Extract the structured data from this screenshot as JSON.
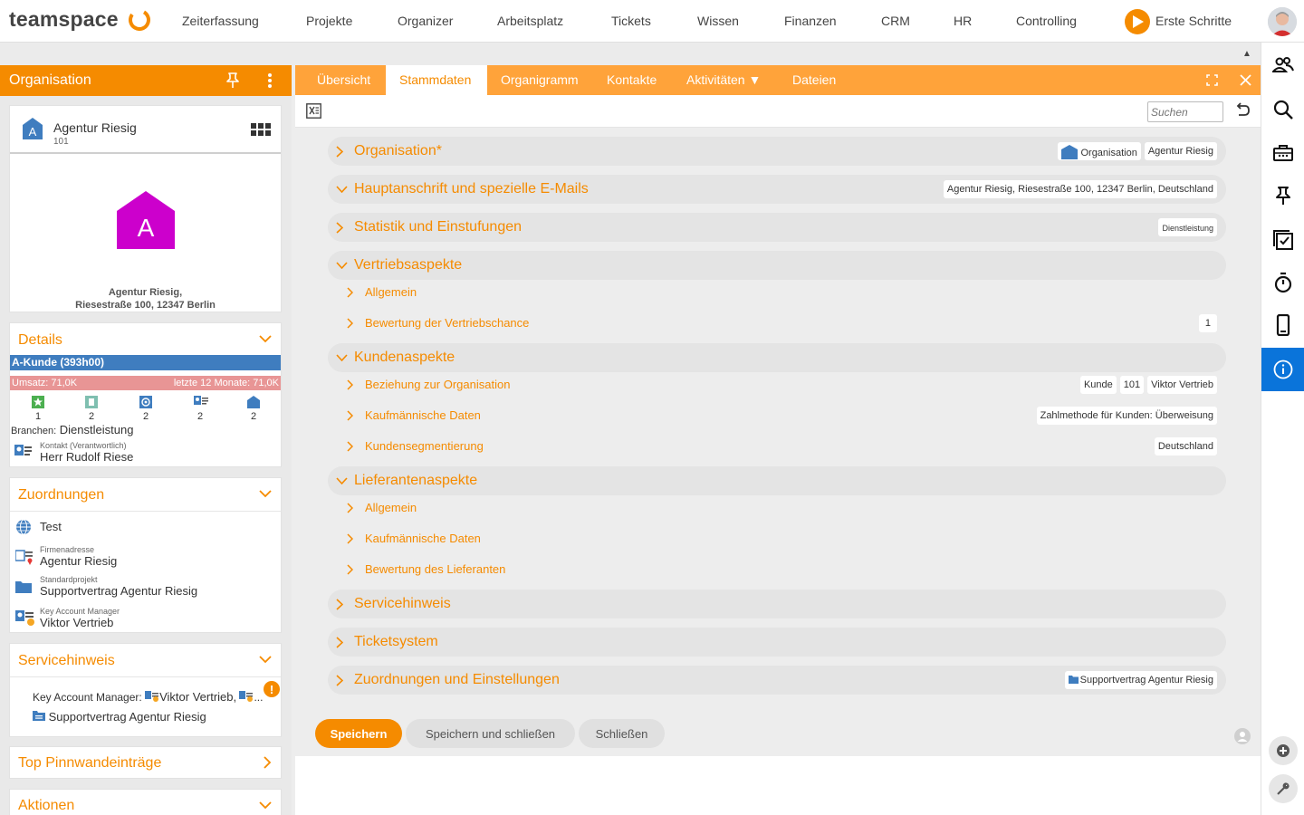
{
  "app": {
    "logo_text": "teamspace",
    "nav": [
      "Zeiterfassung",
      "Projekte",
      "Organizer",
      "Arbeitsplatz",
      "Tickets",
      "Wissen",
      "Finanzen",
      "CRM",
      "HR",
      "Controlling"
    ],
    "erste_schritte": "Erste Schritte"
  },
  "left": {
    "header_title": "Organisation",
    "entity": {
      "name": "Agentur Riesig",
      "number": "101",
      "big_letter": "A",
      "small_letter": "A",
      "address_line1": "Agentur Riesig,",
      "address_line2": "Riesestraße 100, 12347 Berlin"
    },
    "details": {
      "title": "Details",
      "kunde": "A-Kunde (393h00)",
      "umsatz": "Umsatz: 71,0K",
      "letzte": "letzte 12 Monate: 71,0K",
      "stats": [
        "1",
        "2",
        "2",
        "2",
        "2"
      ],
      "branchen_label": "Branchen:",
      "branchen_value": "Dienstleistung",
      "kontakt_label": "Kontakt (Verantwortlich)",
      "kontakt_name": "Herr Rudolf Riese"
    },
    "zuordnungen": {
      "title": "Zuordnungen",
      "test": "Test",
      "firmenadresse_label": "Firmenadresse",
      "firmenadresse_value": "Agentur Riesig",
      "standardprojekt_label": "Standardprojekt",
      "standardprojekt_value": "Supportvertrag Agentur Riesig",
      "kam_label": "Key Account Manager",
      "kam_value": "Viktor Vertrieb"
    },
    "servicehinweis": {
      "title": "Servicehinweis",
      "kam_prefix": "Key Account Manager:",
      "kam_value": "Viktor Vertrieb,",
      "ellipsis": "...",
      "project": "Supportvertrag Agentur Riesig",
      "warn_glyph": "!"
    },
    "pinnwand_title": "Top Pinnwandeinträge",
    "aktionen_title": "Aktionen"
  },
  "main": {
    "tabs": [
      "Übersicht",
      "Stammdaten",
      "Organigramm",
      "Kontakte",
      "Aktivitäten ▼",
      "Dateien"
    ],
    "active_tab": "Stammdaten",
    "search_placeholder": "Suchen",
    "sections": {
      "organisation": {
        "label": "Organisation*",
        "tag1": "Organisation",
        "tag2": "Agentur Riesig"
      },
      "hauptanschrift": {
        "label": "Hauptanschrift und spezielle E-Mails",
        "tag": "Agentur Riesig, Riesestraße 100, 12347 Berlin, Deutschland"
      },
      "statistik": {
        "label": "Statistik und Einstufungen",
        "tag": "Dienstleistung"
      },
      "vertrieb": {
        "label": "Vertriebsaspekte",
        "sub1": "Allgemein",
        "sub2": "Bewertung der Vertriebschance",
        "sub2_tag": "1"
      },
      "kunden": {
        "label": "Kundenaspekte",
        "sub1": "Beziehung zur Organisation",
        "sub1_tags": [
          "Kunde",
          "101",
          "Viktor Vertrieb"
        ],
        "sub2": "Kaufmännische Daten",
        "sub2_tag": "Zahlmethode für Kunden: Überweisung",
        "sub3": "Kundensegmentierung",
        "sub3_tag": "Deutschland"
      },
      "lieferanten": {
        "label": "Lieferantenaspekte",
        "sub1": "Allgemein",
        "sub2": "Kaufmännische Daten",
        "sub3": "Bewertung des Lieferanten"
      },
      "servicehinweis": {
        "label": "Servicehinweis"
      },
      "ticketsystem": {
        "label": "Ticketsystem"
      },
      "zuordnungen": {
        "label": "Zuordnungen und Einstellungen",
        "tag": "Supportvertrag Agentur Riesig"
      }
    },
    "buttons": {
      "save": "Speichern",
      "save_close": "Speichern und schließen",
      "close": "Schließen"
    }
  },
  "colors": {
    "accent": "#f58b00",
    "tab_bar": "#ffa33a",
    "kunde_bar": "#3f7dbf",
    "umsatz_bar": "#e89595",
    "entity_magenta": "#cc00cc",
    "info_blue": "#0a74da"
  },
  "icons": [
    "logo-swirl-icon",
    "play-icon",
    "pin-icon",
    "more-vertical-icon",
    "house-icon",
    "grid-icon",
    "chevron-down-icon",
    "chevron-right-icon",
    "globe-icon",
    "contact-card-icon",
    "folder-icon",
    "warning-icon",
    "excel-icon",
    "undo-icon",
    "expand-icon",
    "close-icon",
    "people-icon",
    "search-icon",
    "briefcase-icon",
    "checklist-icon",
    "stopwatch-icon",
    "phone-icon",
    "info-icon",
    "plus-circle-icon",
    "wrench-icon",
    "user-icon"
  ]
}
